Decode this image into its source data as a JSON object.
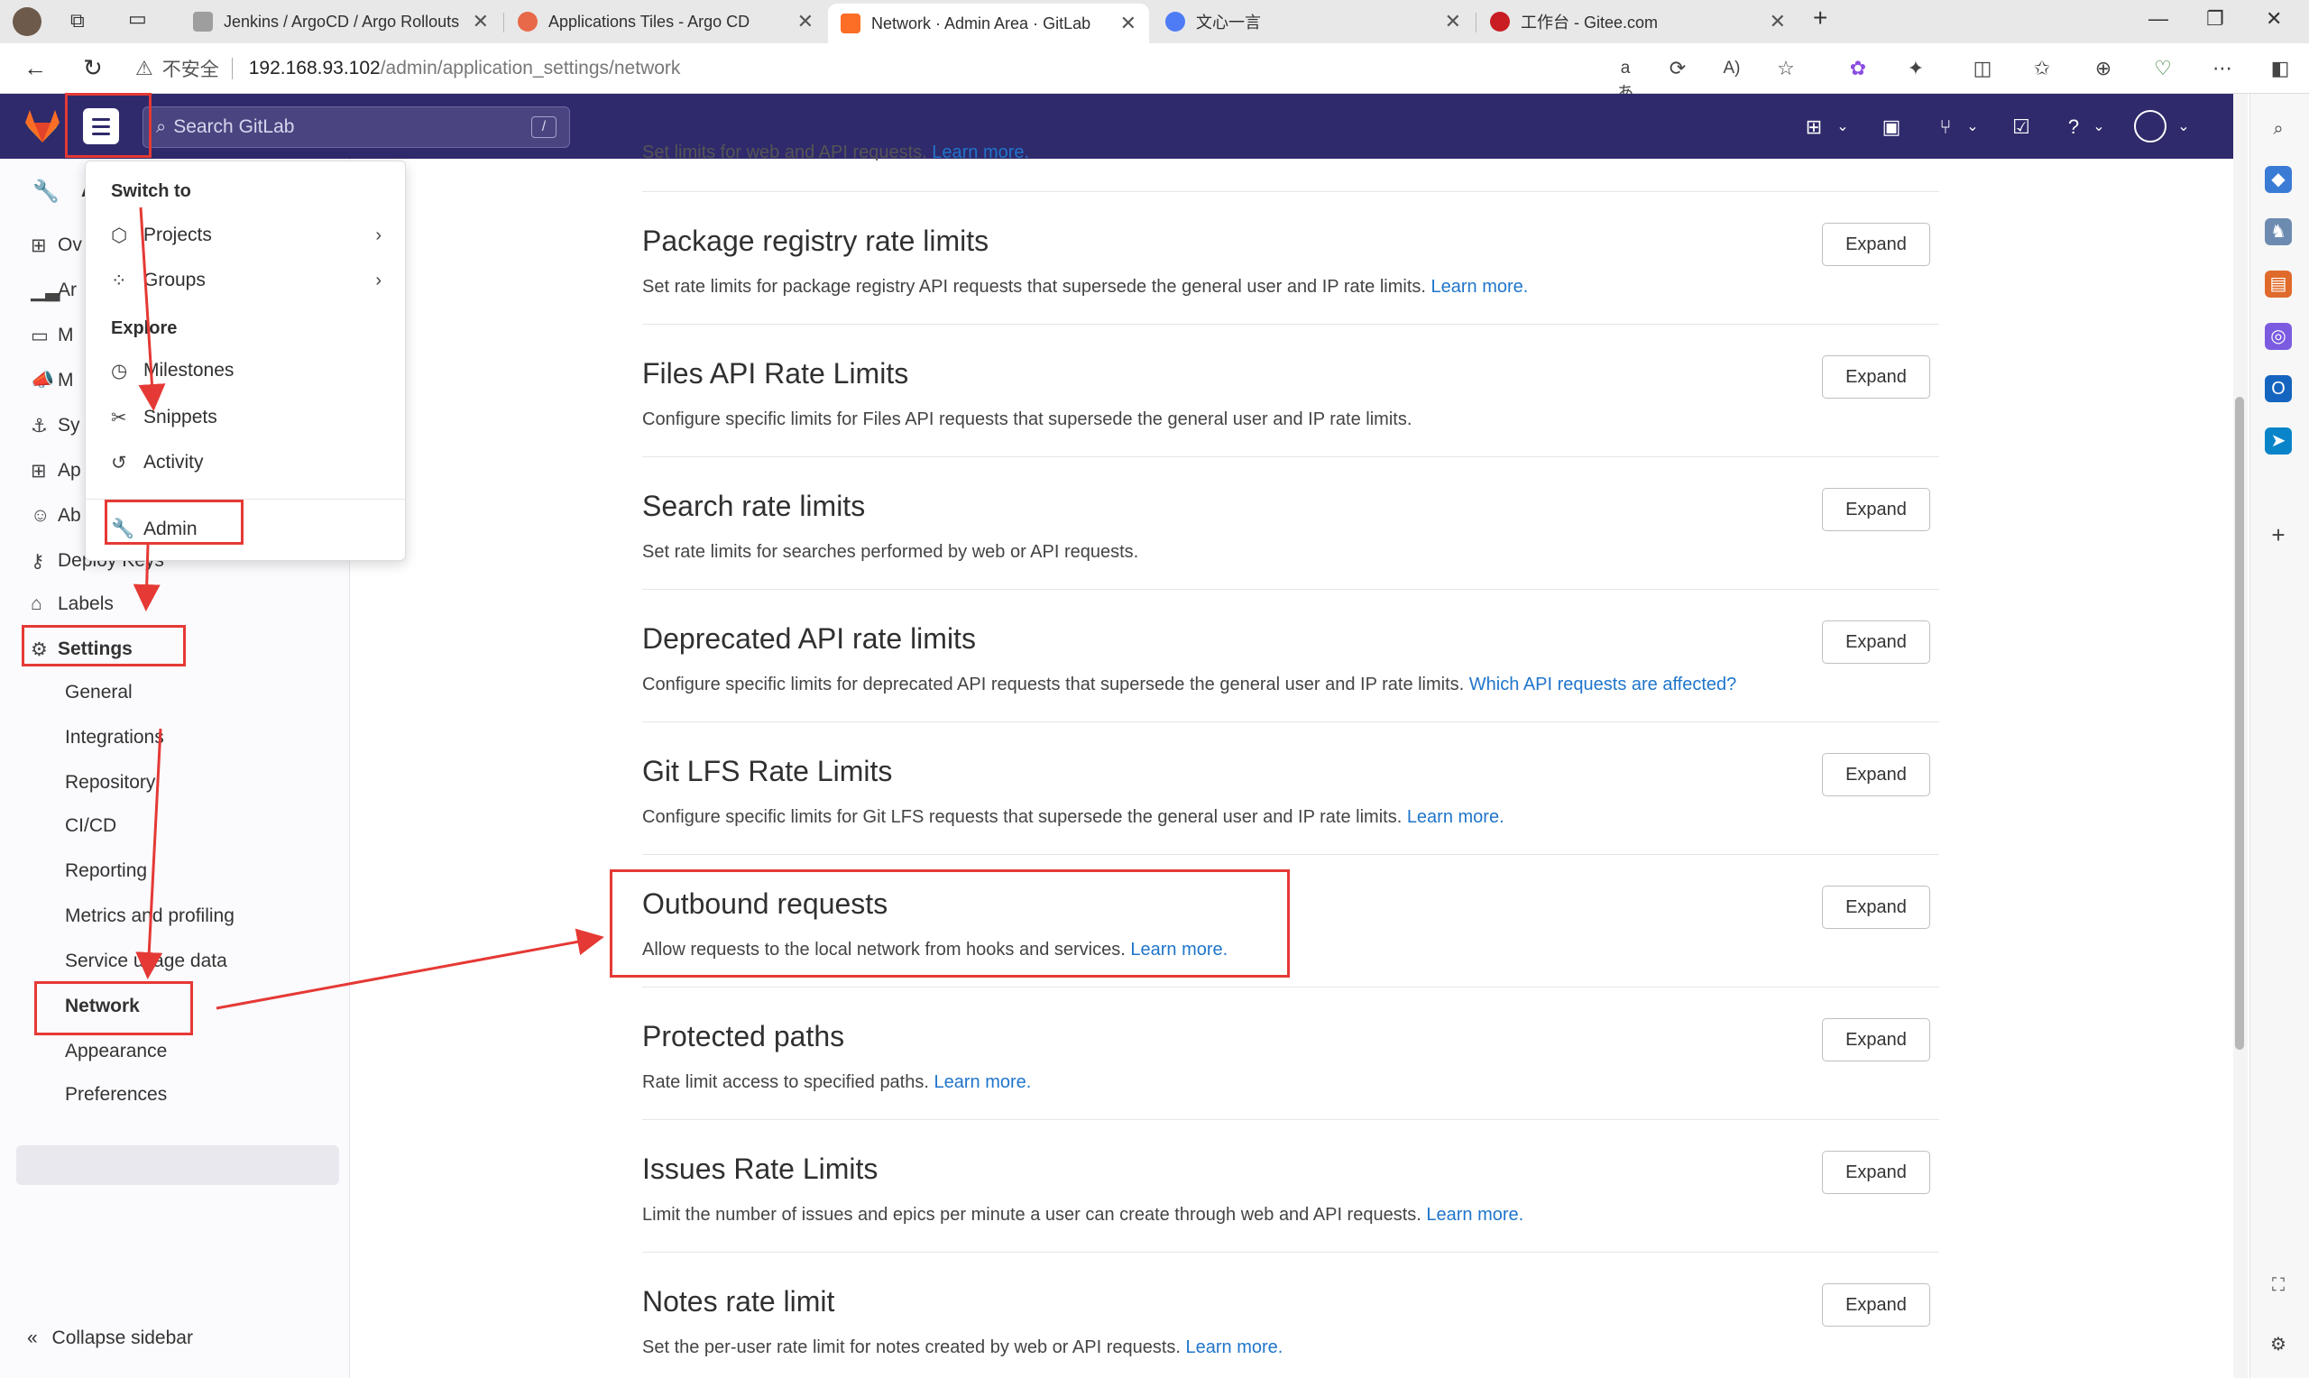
{
  "browser": {
    "tabs": [
      {
        "title": "Jenkins / ArgoCD / Argo Rollouts",
        "color": "#9e9e9e"
      },
      {
        "title": "Applications Tiles - Argo CD",
        "color": "#e8694a"
      },
      {
        "title": "Network · Admin Area · GitLab",
        "color": "#fc6d26"
      },
      {
        "title": "文心一言",
        "color": "#4e7cf6"
      },
      {
        "title": "工作台 - Gitee.com",
        "color": "#c71d23"
      }
    ],
    "insecure_label": "不安全",
    "url_host": "192.168.93.102",
    "url_path": "/admin/application_settings/network"
  },
  "gitlab": {
    "search_placeholder": "Search GitLab",
    "search_shortcut": "/"
  },
  "dropdown": {
    "switch_to_header": "Switch to",
    "explore_header": "Explore",
    "items": {
      "projects": "Projects",
      "groups": "Groups",
      "milestones": "Milestones",
      "snippets": "Snippets",
      "activity": "Activity",
      "admin": "Admin"
    }
  },
  "sidebar": {
    "partial_items": [
      "A",
      "Ov",
      "Ar",
      "M",
      "M",
      "Sy",
      "Ap",
      "Ab"
    ],
    "deploy_keys": "Deploy Keys",
    "labels": "Labels",
    "settings": "Settings",
    "sub_items": [
      "General",
      "Integrations",
      "Repository",
      "CI/CD",
      "Reporting",
      "Metrics and profiling",
      "Service usage data",
      "Network",
      "Appearance",
      "Preferences"
    ],
    "collapse": "Collapse sidebar"
  },
  "main": {
    "partial_top": "Set limits for web and API requests.",
    "partial_top_link": "Learn more.",
    "expand_label": "Expand",
    "sections": [
      {
        "title": "Package registry rate limits",
        "desc": "Set rate limits for package registry API requests that supersede the general user and IP rate limits.",
        "link": "Learn more."
      },
      {
        "title": "Files API Rate Limits",
        "desc": "Configure specific limits for Files API requests that supersede the general user and IP rate limits.",
        "link": ""
      },
      {
        "title": "Search rate limits",
        "desc": "Set rate limits for searches performed by web or API requests.",
        "link": ""
      },
      {
        "title": "Deprecated API rate limits",
        "desc": "Configure specific limits for deprecated API requests that supersede the general user and IP rate limits.",
        "link": "Which API requests are affected?"
      },
      {
        "title": "Git LFS Rate Limits",
        "desc": "Configure specific limits for Git LFS requests that supersede the general user and IP rate limits.",
        "link": "Learn more."
      },
      {
        "title": "Outbound requests",
        "desc": "Allow requests to the local network from hooks and services.",
        "link": "Learn more."
      },
      {
        "title": "Protected paths",
        "desc": "Rate limit access to specified paths.",
        "link": "Learn more."
      },
      {
        "title": "Issues Rate Limits",
        "desc": "Limit the number of issues and epics per minute a user can create through web and API requests.",
        "link": "Learn more."
      },
      {
        "title": "Notes rate limit",
        "desc": "Set the per-user rate limit for notes created by web or API requests.",
        "link": "Learn more."
      }
    ]
  },
  "colors": {
    "gitlab_nav": "#2f2a6b",
    "link": "#1f75cb",
    "annotation": "#e53935"
  }
}
